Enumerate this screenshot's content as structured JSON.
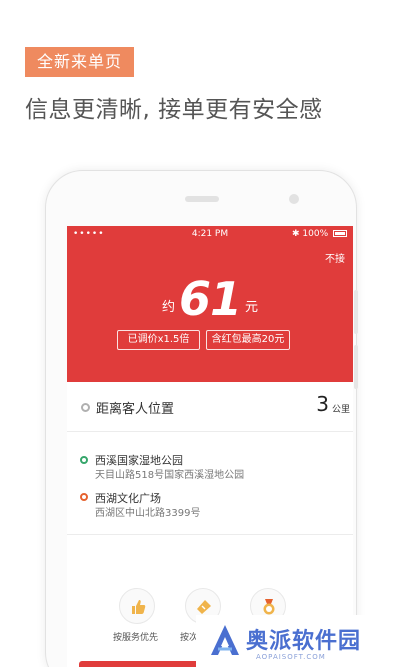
{
  "promo": {
    "badge": "全新来单页",
    "headline": "信息更清晰, 接单更有安全感"
  },
  "status_bar": {
    "signal": "•••••",
    "time": "4:21 PM",
    "battery": "100%"
  },
  "order": {
    "reject_label": "不接",
    "fare_prefix": "约",
    "fare_value": "61",
    "fare_unit": "元",
    "tags": [
      "已调价x1.5倍",
      "含红包最高20元"
    ]
  },
  "distance": {
    "label": "距离客人位置",
    "value": "3",
    "unit": "公里"
  },
  "addresses": [
    {
      "title": "西溪国家湿地公园",
      "detail": "天目山路518号国家西溪湿地公园"
    },
    {
      "title": "西湖文化广场",
      "detail": "西湖区中山北路3399号"
    }
  ],
  "preferences": [
    {
      "label": "按服务优先",
      "icon": "thumbs-up-icon"
    },
    {
      "label": "按次",
      "icon": "ticket-icon"
    },
    {
      "label": "",
      "icon": "medal-icon"
    }
  ],
  "watermark": {
    "text": "奥派软件园",
    "url": "AOPAISOFT.COM"
  },
  "colors": {
    "accent_red": "#e03c3b",
    "badge_orange": "#ef8a5f",
    "pickup_green": "#36a66b",
    "dropoff_orange": "#e5622f"
  }
}
